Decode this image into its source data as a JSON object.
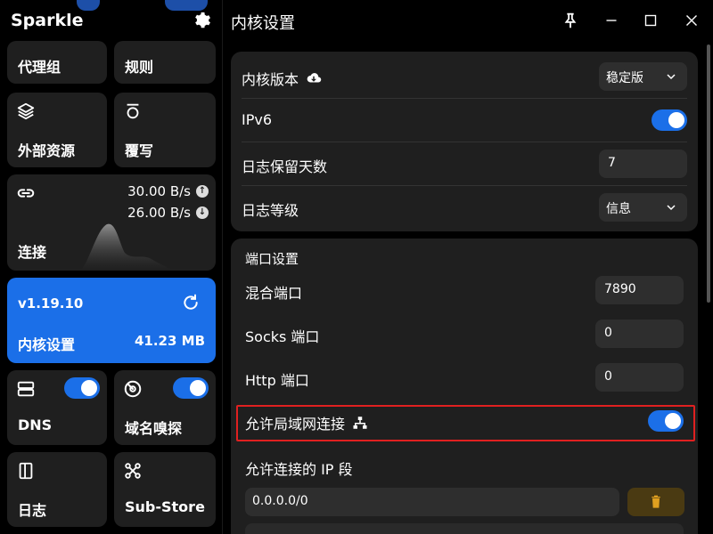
{
  "app": {
    "title": "Sparkle"
  },
  "sidebar": {
    "proxy_group": "代理组",
    "rules": "规则",
    "external_resources": "外部资源",
    "override": "覆写",
    "connections": {
      "label": "连接",
      "upload_speed": "30.00 B/s",
      "download_speed": "26.00 B/s"
    },
    "core_card": {
      "version": "v1.19.10",
      "label": "内核设置",
      "memory": "41.23 MB",
      "accent": "#1b6fe8"
    },
    "dns": {
      "label": "DNS",
      "enabled": true
    },
    "sniff": {
      "label": "域名嗅探",
      "enabled": true
    },
    "logs": "日志",
    "substore": "Sub-Store"
  },
  "header": {
    "title": "内核设置"
  },
  "core_panel": {
    "core_version_label": "内核版本",
    "core_version_value": "稳定版",
    "ipv6_label": "IPv6",
    "ipv6_enabled": true,
    "log_retention_label": "日志保留天数",
    "log_retention_value": "7",
    "log_level_label": "日志等级",
    "log_level_value": "信息"
  },
  "port_panel": {
    "title": "端口设置",
    "mixed_port_label": "混合端口",
    "mixed_port_value": "7890",
    "socks_port_label": "Socks 端口",
    "socks_port_value": "0",
    "http_port_label": "Http 端口",
    "http_port_value": "0",
    "allow_lan_label": "允许局域网连接",
    "allow_lan_enabled": true,
    "allowed_ips_label": "允许连接的 IP 段",
    "allowed_ip_value": "0.0.0.0/0"
  },
  "colors": {
    "accent": "#1b6fe8",
    "card": "#1f1f1f",
    "highlight": "#e02020",
    "delete": "#e0a020"
  }
}
